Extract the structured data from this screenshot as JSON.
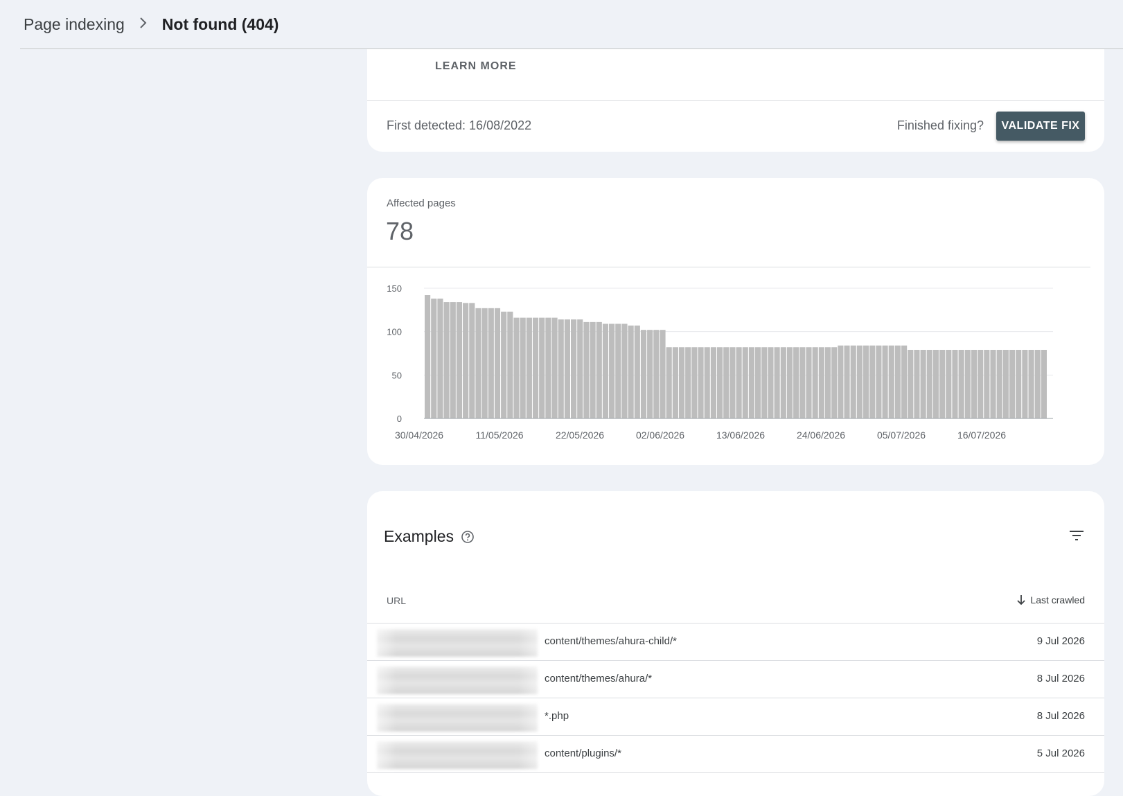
{
  "breadcrumb": {
    "parent": "Page indexing",
    "current": "Not found (404)"
  },
  "issue": {
    "learn_more": "LEARN MORE",
    "first_detected": "First detected: 16/08/2022",
    "finished_fixing": "Finished fixing?",
    "validate_label": "VALIDATE FIX"
  },
  "affected": {
    "label": "Affected pages",
    "value": "78"
  },
  "chart_data": {
    "type": "bar",
    "ylim": [
      0,
      150
    ],
    "yticks": [
      0,
      50,
      100,
      150
    ],
    "xtick_labels": [
      "30/04/2026",
      "11/05/2026",
      "22/05/2026",
      "02/06/2026",
      "13/06/2026",
      "24/06/2026",
      "05/07/2026",
      "16/07/2026"
    ],
    "grid": true,
    "bar_color": "#bdbdbd",
    "values": [
      142,
      138,
      138,
      134,
      134,
      134,
      133,
      133,
      127,
      127,
      127,
      127,
      123,
      123,
      116,
      116,
      116,
      116,
      116,
      116,
      116,
      114,
      114,
      114,
      114,
      111,
      111,
      111,
      109,
      109,
      109,
      109,
      107,
      107,
      102,
      102,
      102,
      102,
      82,
      82,
      82,
      82,
      82,
      82,
      82,
      82,
      82,
      82,
      82,
      82,
      82,
      82,
      82,
      82,
      82,
      82,
      82,
      82,
      82,
      82,
      82,
      82,
      82,
      82,
      82,
      84,
      84,
      84,
      84,
      84,
      84,
      84,
      84,
      84,
      84,
      84,
      79,
      79,
      79,
      79,
      79,
      79,
      79,
      79,
      79,
      79,
      79,
      79,
      79,
      79,
      79,
      79,
      79,
      79,
      79,
      79,
      79,
      79
    ]
  },
  "examples": {
    "title": "Examples",
    "col_url": "URL",
    "col_last_crawled": "Last crawled",
    "rows": [
      {
        "url": "content/themes/ahura-child/*",
        "date": "9 Jul 2026"
      },
      {
        "url": "content/themes/ahura/*",
        "date": "8 Jul 2026"
      },
      {
        "url": "*.php",
        "date": "8 Jul 2026"
      },
      {
        "url": "content/plugins/*",
        "date": "5 Jul 2026"
      }
    ]
  },
  "colors": {
    "button_bg": "#455a64",
    "page_bg": "#eff2f7"
  },
  "icons": {
    "breadcrumb_separator": "chevron-right-icon",
    "help": "help-circle-icon",
    "filter": "filter-icon",
    "sort": "arrow-down-icon"
  }
}
